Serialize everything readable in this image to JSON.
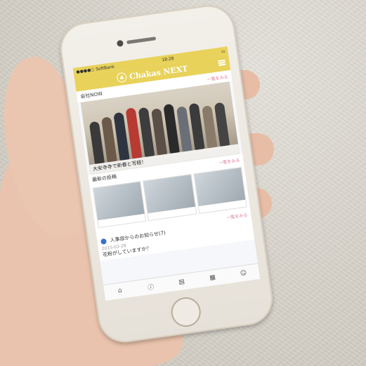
{
  "app": {
    "status_carrier": "●●●●○ SoftBank",
    "status_time": "18:28",
    "title": "Chakas NEXT"
  },
  "sections": {
    "company_now": "会社NOW",
    "company_now_more": "一覧をみる",
    "hero_caption": "大安寺寺で新春と写経！",
    "latest_posts": "最新の投稿",
    "latest_posts_more": "一覧をみる",
    "notice_heading": "人事部からのお知らせ(7)",
    "notice_date": "2015-03-28",
    "notice_text": "花粉がしていますか？",
    "notice_more": "一覧をみる"
  },
  "tabs": [
    "home-icon",
    "info-icon",
    "board-icon",
    "calendar-icon",
    "people-icon"
  ]
}
